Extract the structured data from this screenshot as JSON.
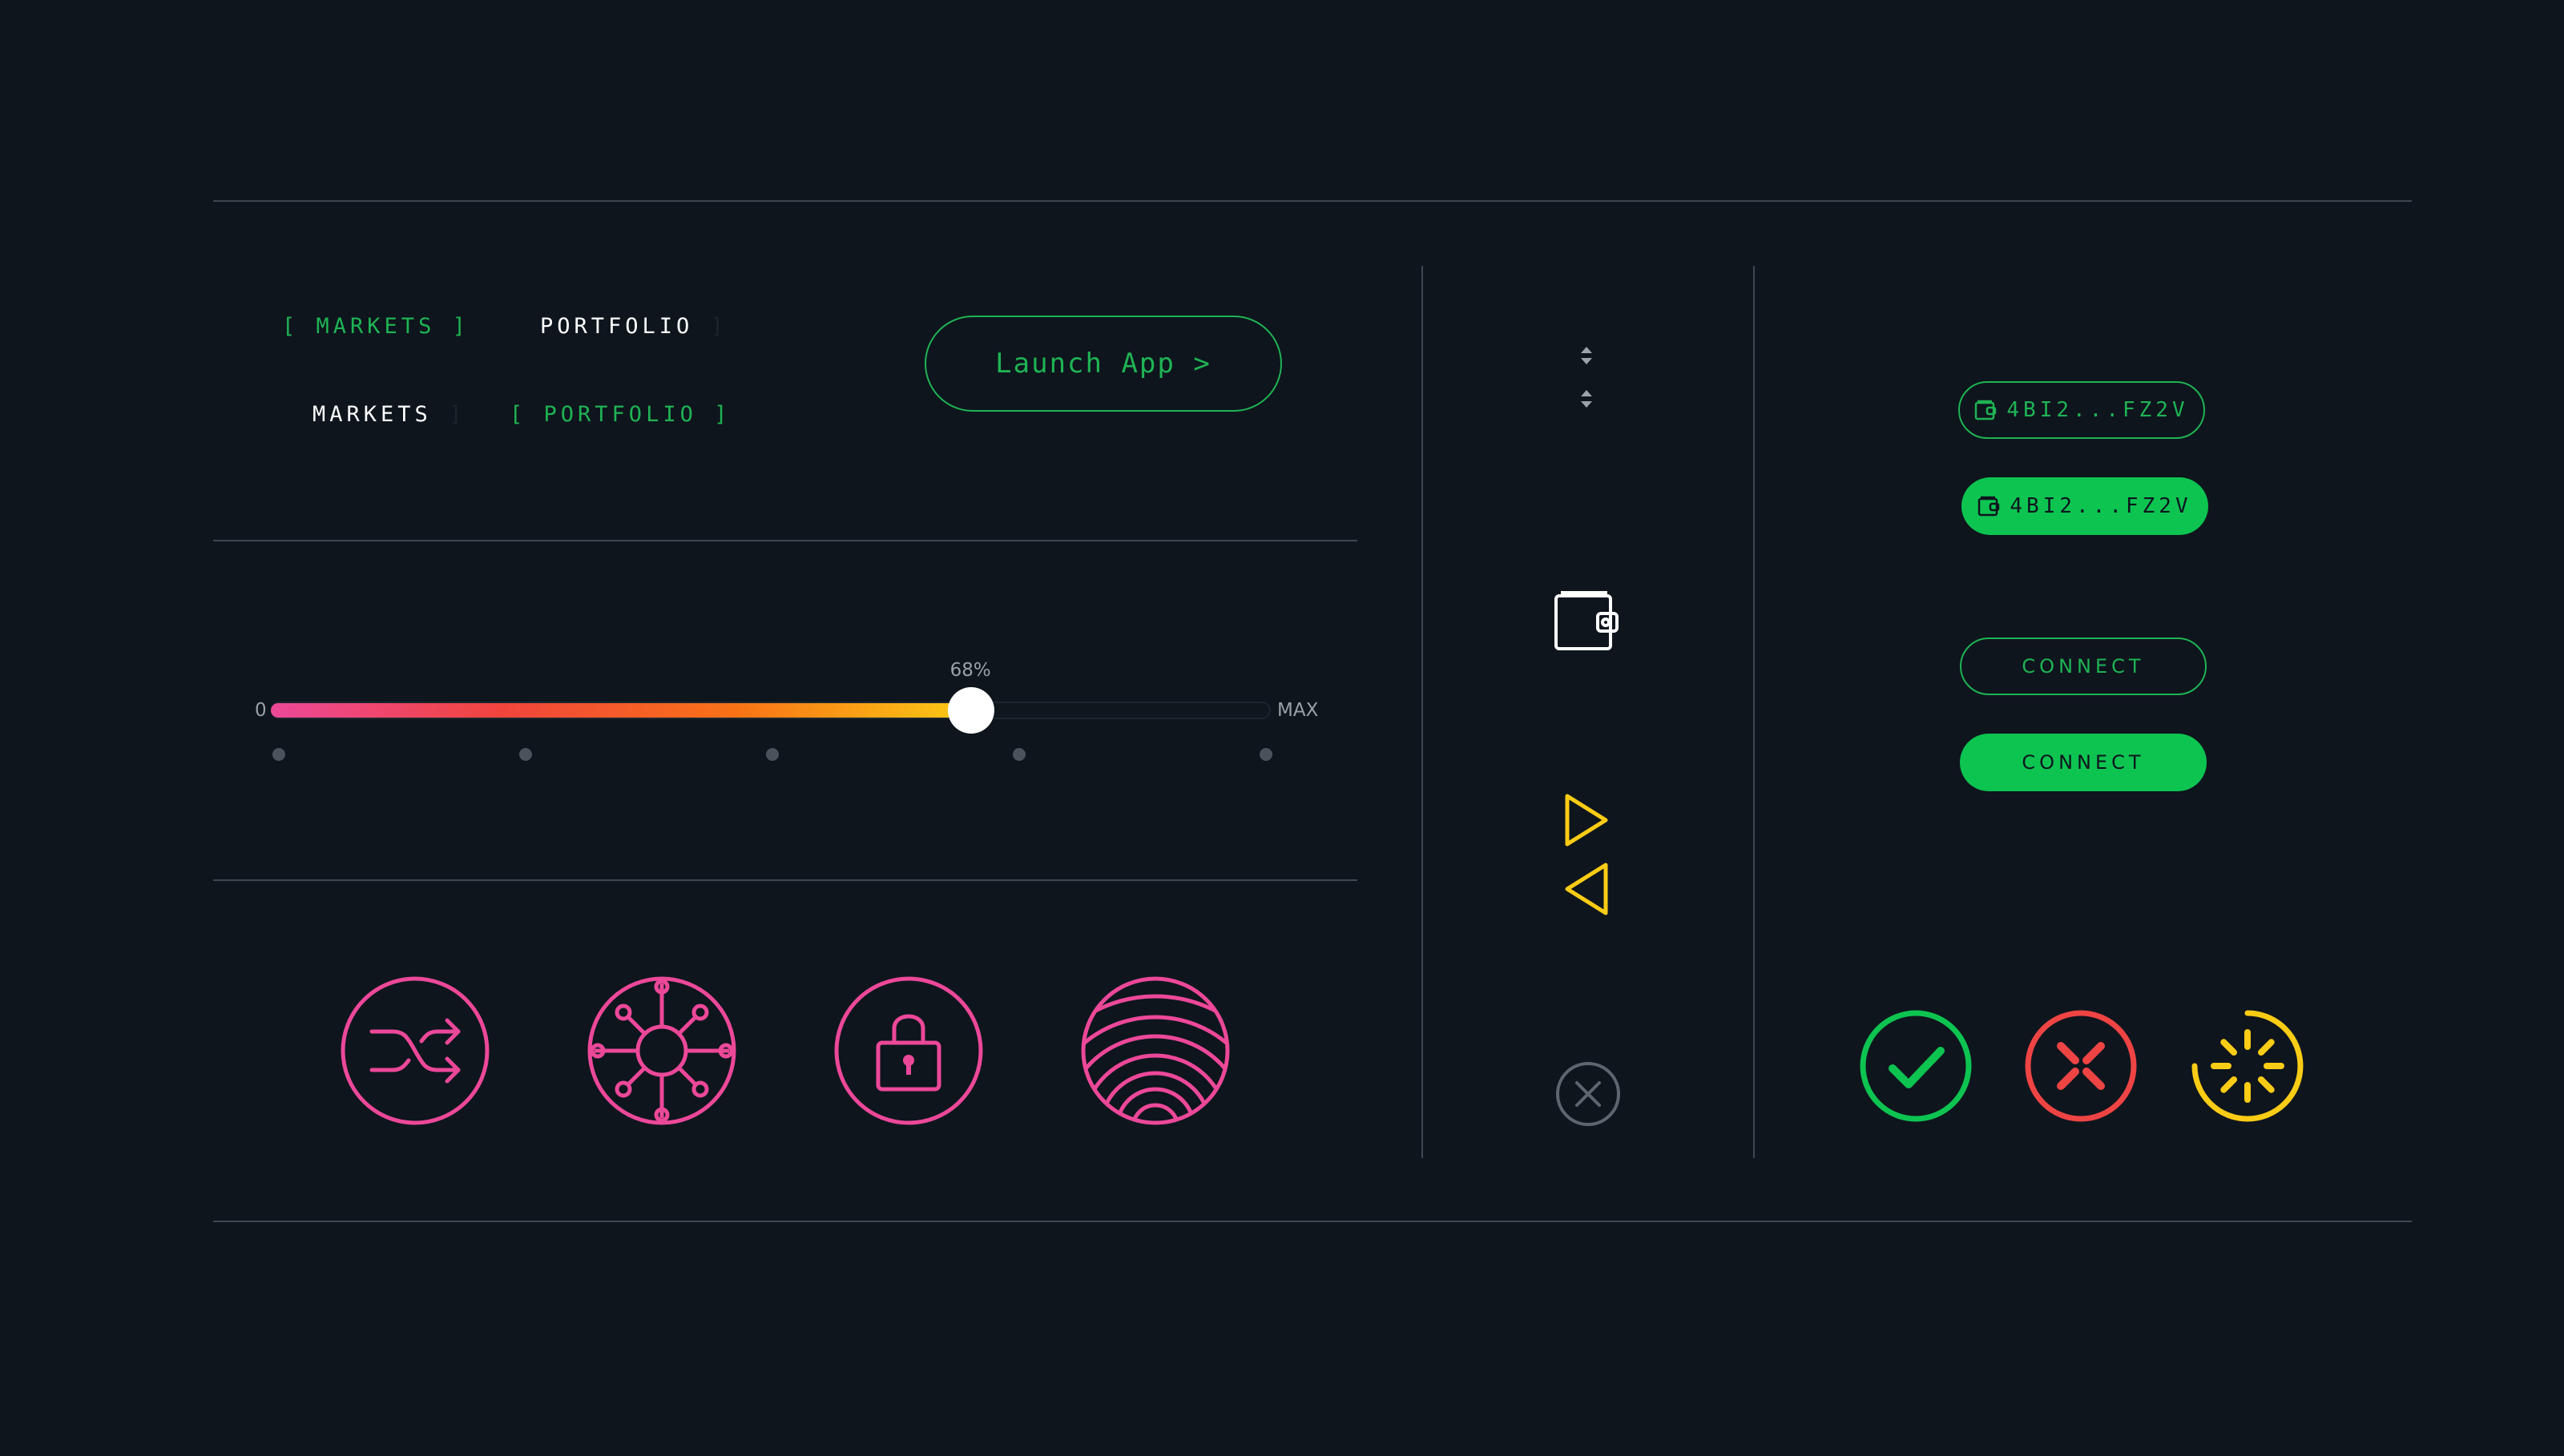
{
  "nav": {
    "row1": {
      "markets_label": "MARKETS",
      "portfolio_label": "PORTFOLIO",
      "active": "markets"
    },
    "row2": {
      "markets_label": "MARKETS",
      "portfolio_label": "PORTFOLIO",
      "active": "portfolio"
    },
    "bracket_open": "[",
    "bracket_close": "]"
  },
  "launch_button": {
    "label": "Launch App >"
  },
  "slider": {
    "min_label": "0",
    "max_label": "MAX",
    "value_label": "68%",
    "value_fraction": 0.7,
    "tick_count": 5,
    "gradient": [
      "#ec4899",
      "#f0453c",
      "#f97316",
      "#facc15"
    ]
  },
  "feature_icons": [
    "shuffle-icon",
    "network-hub-icon",
    "lock-icon",
    "concentric-rings-icon"
  ],
  "middle_column": {
    "icons": [
      "sort-arrows-icon",
      "sort-arrows-icon",
      "wallet-icon",
      "play-right-icon",
      "play-left-icon",
      "close-circle-icon"
    ]
  },
  "wallet": {
    "address_outline": "4BI2...FZ2V",
    "address_filled": "4BI2...FZ2V"
  },
  "connect": {
    "outline_label": "CONNECT",
    "filled_label": "CONNECT"
  },
  "status_icons": [
    "success-check-icon",
    "error-x-icon",
    "loading-spinner-icon"
  ],
  "colors": {
    "background": "#0e151d",
    "accent_green": "#1fb354",
    "filled_green": "#0dc451",
    "pink": "#ec4899",
    "yellow": "#facc15",
    "red": "#ef4444",
    "divider": "#3e474f"
  }
}
